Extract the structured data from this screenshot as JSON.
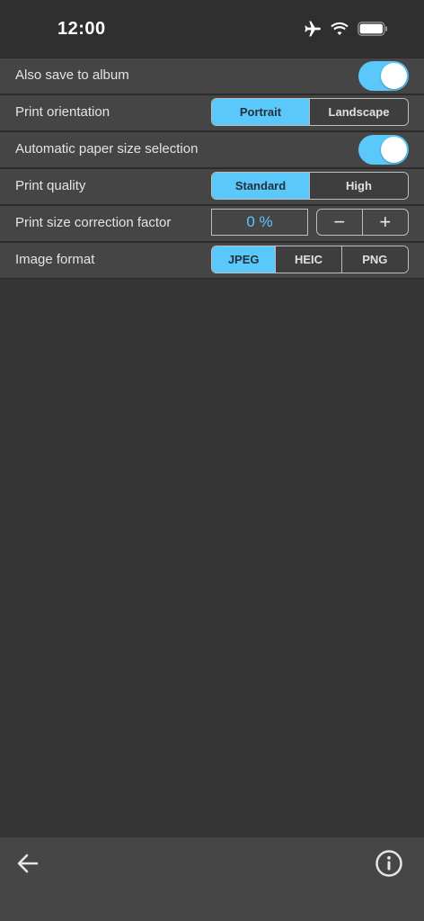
{
  "status_bar": {
    "time": "12:00",
    "icons": [
      "airplane-icon",
      "wifi-icon",
      "battery-icon"
    ]
  },
  "settings": {
    "save_to_album": {
      "label": "Also save to album",
      "enabled": true
    },
    "print_orientation": {
      "label": "Print orientation",
      "options": [
        "Portrait",
        "Landscape"
      ],
      "selected": "Portrait"
    },
    "auto_paper_size": {
      "label": "Automatic paper size selection",
      "enabled": true
    },
    "print_quality": {
      "label": "Print quality",
      "options": [
        "Standard",
        "High"
      ],
      "selected": "Standard"
    },
    "size_correction": {
      "label": "Print size correction factor",
      "value": "0 %",
      "decrement": "−",
      "increment": "+"
    },
    "image_format": {
      "label": "Image format",
      "options": [
        "JPEG",
        "HEIC",
        "PNG"
      ],
      "selected": "JPEG"
    }
  },
  "toolbar": {
    "back_icon": "arrow-left-icon",
    "info_icon": "info-circle-icon"
  },
  "colors": {
    "accent": "#5ac8fa",
    "background": "#343434",
    "row_background": "#454545",
    "toolbar_background": "#464646"
  }
}
